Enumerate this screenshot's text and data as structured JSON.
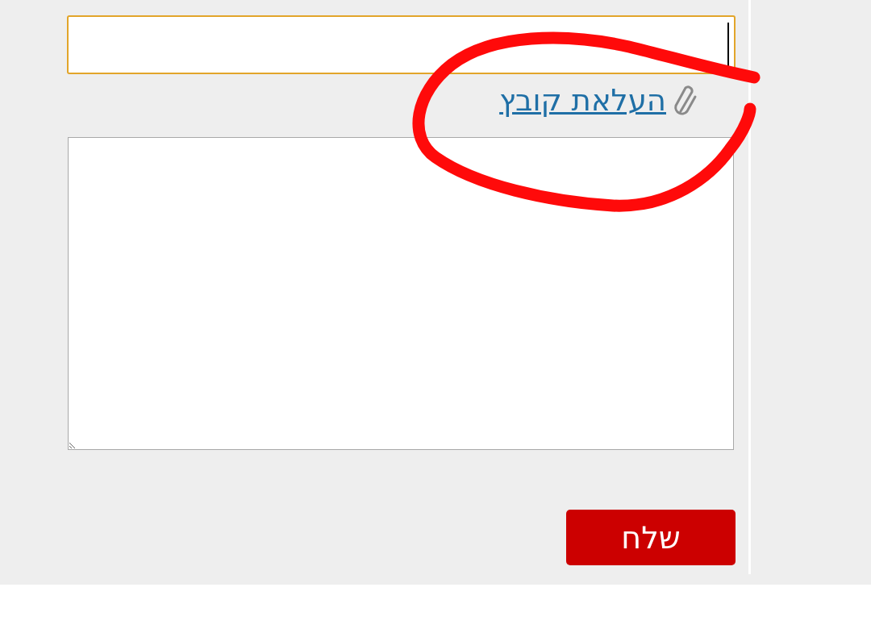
{
  "message_input": {
    "focused": true
  },
  "upload_link": {
    "label": "העלאת קובץ"
  },
  "send_button": {
    "label": "שלח"
  }
}
